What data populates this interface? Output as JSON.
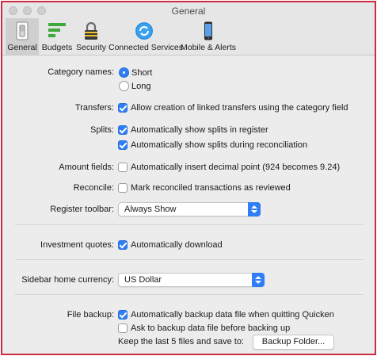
{
  "window": {
    "title": "General"
  },
  "toolbar": {
    "tabs": [
      {
        "label": "General"
      },
      {
        "label": "Budgets"
      },
      {
        "label": "Security"
      },
      {
        "label": "Connected Services"
      },
      {
        "label": "Mobile & Alerts"
      }
    ],
    "selected": "General"
  },
  "prefs": {
    "category_names": {
      "label": "Category names:",
      "options": [
        {
          "label": "Short",
          "selected": true
        },
        {
          "label": "Long",
          "selected": false
        }
      ]
    },
    "transfers": {
      "label": "Transfers:",
      "checkbox": {
        "label": "Allow creation of linked transfers using the category field",
        "checked": true
      }
    },
    "splits": {
      "label": "Splits:",
      "checkboxes": [
        {
          "label": "Automatically show splits in register",
          "checked": true
        },
        {
          "label": "Automatically show splits during reconciliation",
          "checked": true
        }
      ]
    },
    "amount_fields": {
      "label": "Amount fields:",
      "checkbox": {
        "label": "Automatically insert decimal point (924 becomes 9.24)",
        "checked": false
      }
    },
    "reconcile": {
      "label": "Reconcile:",
      "checkbox": {
        "label": "Mark reconciled transactions as reviewed",
        "checked": false
      }
    },
    "register_toolbar": {
      "label": "Register toolbar:",
      "value": "Always Show"
    },
    "investment_quotes": {
      "label": "Investment quotes:",
      "checkbox": {
        "label": "Automatically download",
        "checked": true
      }
    },
    "sidebar_currency": {
      "label": "Sidebar home currency:",
      "value": "US Dollar"
    },
    "file_backup": {
      "label": "File backup:",
      "checkboxes": [
        {
          "label": "Automatically backup data file when quitting Quicken",
          "checked": true
        },
        {
          "label": "Ask to backup data file before backing up",
          "checked": false
        }
      ],
      "keep_text": "Keep the last 5 files and save to:",
      "folder_button": "Backup Folder..."
    }
  },
  "colors": {
    "accent": "#2f7ef5",
    "frame_border": "#cc2b44"
  }
}
